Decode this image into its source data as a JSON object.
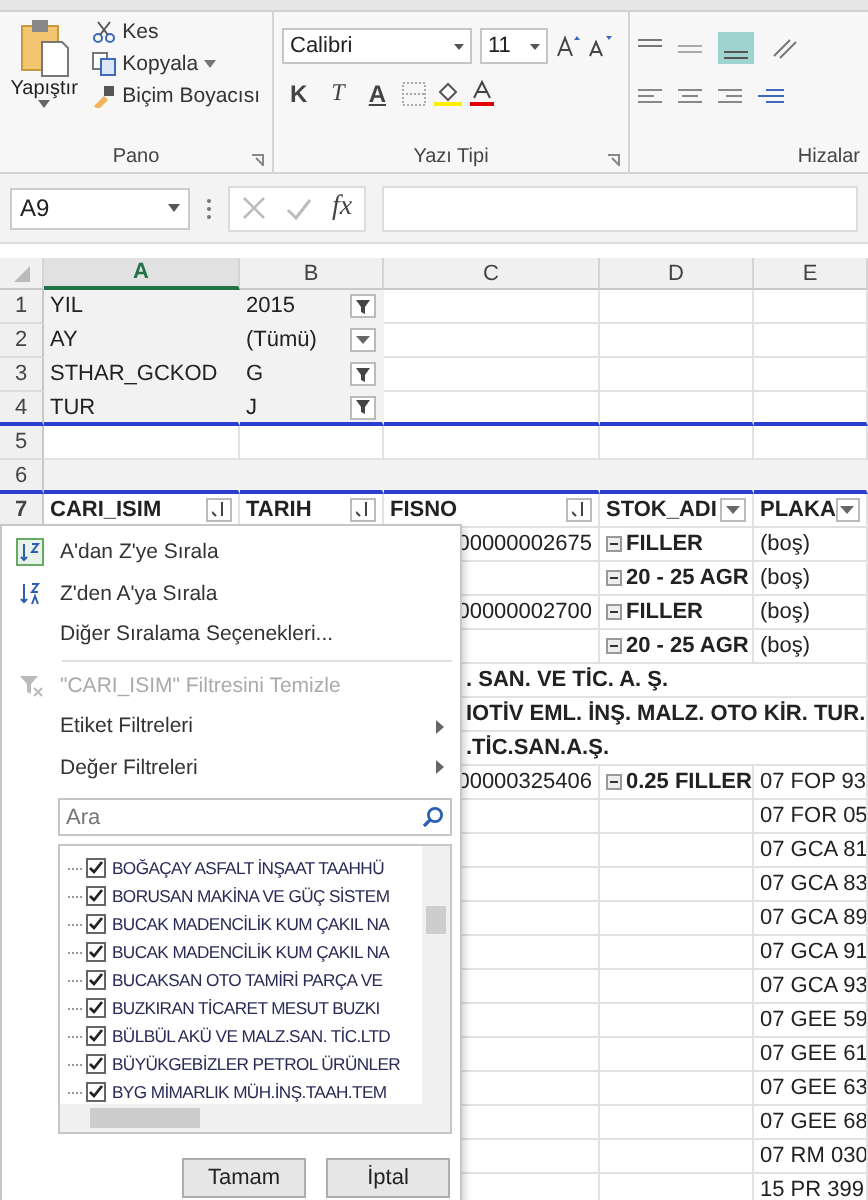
{
  "ribbon": {
    "clipboard": {
      "paste": "Yapıştır",
      "cut": "Kes",
      "copy": "Kopyala",
      "format_painter": "Biçim Boyacısı",
      "label": "Pano"
    },
    "font": {
      "family": "Calibri",
      "size": "11",
      "bold": "K",
      "italic": "T",
      "underline": "A",
      "label": "Yazı Tipi"
    },
    "alignment": {
      "label": "Hizalar"
    }
  },
  "formula_bar": {
    "name_box": "A9",
    "fx": "fx"
  },
  "columns": [
    {
      "label": "A",
      "selected": true
    },
    {
      "label": "B",
      "selected": false
    },
    {
      "label": "C",
      "selected": false
    },
    {
      "label": "D",
      "selected": false
    },
    {
      "label": "E",
      "selected": false
    }
  ],
  "filters": [
    {
      "row": "1",
      "field": "YIL",
      "value": "2015",
      "filtered": true
    },
    {
      "row": "2",
      "field": "AY",
      "value": "(Tümü)",
      "filtered": false
    },
    {
      "row": "3",
      "field": "STHAR_GCKOD",
      "value": "G",
      "filtered": true
    },
    {
      "row": "4",
      "field": "TUR",
      "value": "J",
      "filtered": true
    }
  ],
  "empty_rows": [
    "5",
    "6"
  ],
  "header_row": {
    "row": "7",
    "cells": [
      {
        "label": "CARI_ISIM",
        "kind": "sort"
      },
      {
        "label": "TARIH",
        "kind": "sort"
      },
      {
        "label": "FISNO",
        "kind": "sort"
      },
      {
        "label": "STOK_ADI",
        "kind": "dropdown"
      },
      {
        "label": "PLAKA",
        "kind": "dropdown"
      }
    ]
  },
  "data_rows": [
    {
      "kind": "item",
      "fisno": "00000002675",
      "stok": "FILLER",
      "collapsible": true,
      "plaka": "(boş)"
    },
    {
      "kind": "item",
      "stok": "20 - 25 AGR",
      "collapsible": true,
      "plaka": "(boş)"
    },
    {
      "kind": "item",
      "fisno": "00000002700",
      "stok": "FILLER",
      "collapsible": true,
      "plaka": "(boş)"
    },
    {
      "kind": "item",
      "stok": "20 - 25 AGR",
      "collapsible": true,
      "plaka": "(boş)"
    },
    {
      "kind": "group",
      "text": ". SAN. VE TİC. A. Ş."
    },
    {
      "kind": "group",
      "text": "IOTİV EML. İNŞ. MALZ. OTO KİR. TUR."
    },
    {
      "kind": "group",
      "text": ".TİC.SAN.A.Ş."
    },
    {
      "kind": "item",
      "fisno": "00000325406",
      "stok": "0.25 FILLER",
      "collapsible": true,
      "plaka": "07 FOP 93"
    },
    {
      "kind": "item",
      "plaka": "07 FOR 05"
    },
    {
      "kind": "item",
      "plaka": "07 GCA 81"
    },
    {
      "kind": "item",
      "plaka": "07 GCA 83"
    },
    {
      "kind": "item",
      "plaka": "07 GCA 89"
    },
    {
      "kind": "item",
      "plaka": "07 GCA 91"
    },
    {
      "kind": "item",
      "plaka": "07 GCA 93"
    },
    {
      "kind": "item",
      "plaka": "07 GEE 59"
    },
    {
      "kind": "item",
      "plaka": "07 GEE 61"
    },
    {
      "kind": "item",
      "plaka": "07 GEE 63"
    },
    {
      "kind": "item",
      "plaka": "07 GEE 68"
    },
    {
      "kind": "item",
      "plaka": "07 RM 030"
    },
    {
      "kind": "item",
      "plaka": "15 PR 399"
    }
  ],
  "filter_menu": {
    "items": [
      {
        "kind": "sort_az",
        "label": "A'dan Z'ye Sırala",
        "disabled": false
      },
      {
        "kind": "sort_za",
        "label": "Z'den A'ya Sırala",
        "disabled": false
      },
      {
        "kind": "plain",
        "label": "Diğer Sıralama Seçenekleri...",
        "disabled": false
      },
      {
        "kind": "separator"
      },
      {
        "kind": "clear",
        "label": "\"CARI_ISIM\" Filtresini Temizle",
        "disabled": true
      },
      {
        "kind": "submenu",
        "label": "Etiket Filtreleri",
        "disabled": false
      },
      {
        "kind": "submenu",
        "label": "Değer Filtreleri",
        "disabled": false
      }
    ],
    "search": {
      "placeholder": "Ara"
    },
    "values": [
      {
        "label": "BOĞAÇAY ASFALT İNŞAAT TAAHHÜ",
        "checked": true
      },
      {
        "label": "BORUSAN MAKİNA VE GÜÇ SİSTEM",
        "checked": true
      },
      {
        "label": "BUCAK MADENCİLİK KUM ÇAKIL NA",
        "checked": true
      },
      {
        "label": "BUCAK MADENCİLİK KUM ÇAKIL NA",
        "checked": true
      },
      {
        "label": "BUCAKSAN OTO TAMİRİ PARÇA VE",
        "checked": true
      },
      {
        "label": "BUZKIRAN TİCARET   MESUT BUZKI",
        "checked": true
      },
      {
        "label": "BÜLBÜL AKÜ VE MALZ.SAN. TİC.LTD",
        "checked": true
      },
      {
        "label": "BÜYÜKGEBİZLER PETROL ÜRÜNLER",
        "checked": true
      },
      {
        "label": "BYG MİMARLIK MÜH.İNŞ.TAAH.TEM",
        "checked": true
      }
    ],
    "buttons": [
      "Tamam",
      "İptal"
    ]
  }
}
